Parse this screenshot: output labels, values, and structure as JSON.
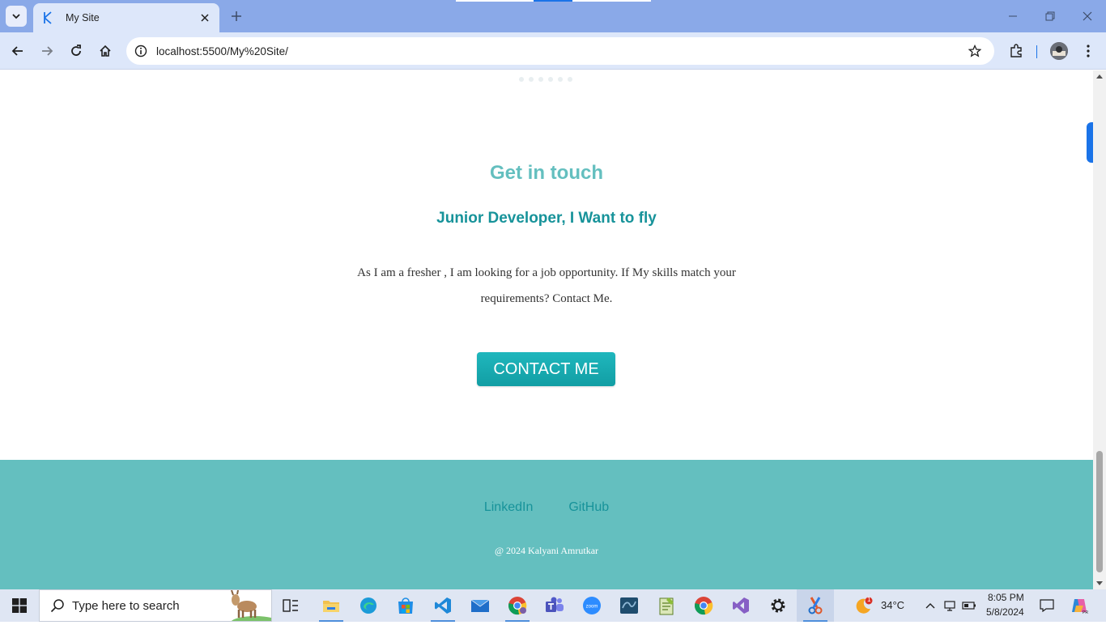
{
  "browser": {
    "tab_title": "My Site",
    "url": "localhost:5500/My%20Site/"
  },
  "page": {
    "heading": "Get in touch",
    "subheading": "Junior Developer, I Want to fly",
    "text": "As I am a fresher , I am looking for a job opportunity. If My skills match your requirements? Contact Me.",
    "contact_button": "CONTACT ME",
    "footer_links": [
      "LinkedIn",
      "GitHub"
    ],
    "copyright": "@ 2024 Kalyani Amrutkar"
  },
  "colors": {
    "accent": "#64bfbf",
    "teal_dark": "#17939a",
    "button": "#1aaeb3"
  },
  "taskbar": {
    "search_placeholder": "Type here to search",
    "weather_badge": "1",
    "temperature": "34°C",
    "time": "8:05 PM",
    "date": "5/8/2024",
    "apps": [
      "task-view",
      "file-explorer",
      "edge",
      "microsoft-store",
      "vscode",
      "mail",
      "chrome-profile",
      "teams",
      "zoom",
      "mysql-workbench",
      "notepad-plus-plus",
      "chrome",
      "visual-studio",
      "settings",
      "snipping-tool"
    ]
  }
}
